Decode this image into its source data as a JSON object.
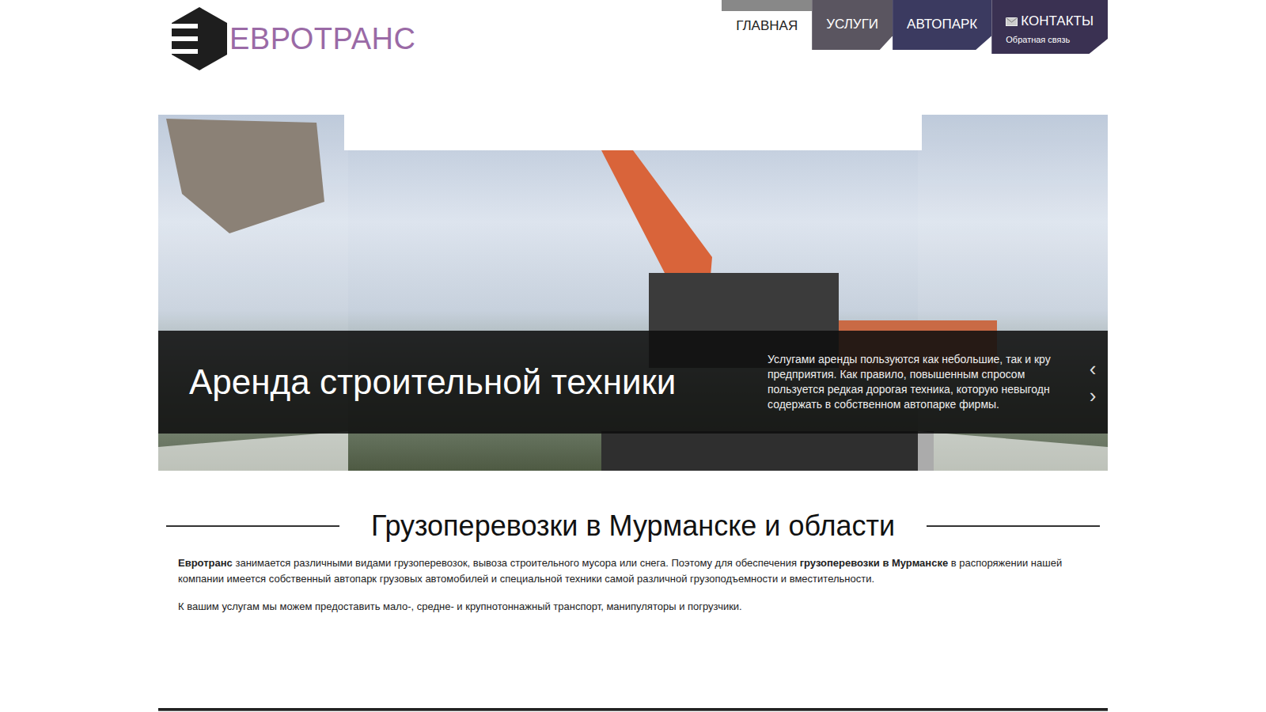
{
  "logo": {
    "text": "ЕВРОТРАНС"
  },
  "nav": [
    {
      "label": "ГЛАВНАЯ",
      "selected": true
    },
    {
      "label": "УСЛУГИ",
      "selected": false
    },
    {
      "label": "АВТОПАРК",
      "selected": false
    },
    {
      "label": "КОНТАКТЫ",
      "sublabel": "Обратная связь",
      "selected": false
    }
  ],
  "slider": {
    "title": "Аренда строительной техники",
    "text_lines": [
      "Услугами аренды пользуются как небольшие, так и кру",
      "предприятия. Как правило, повышенным спросом",
      "пользуется редкая дорогая техника, которую невыгодн",
      "содержать в собственном автопарке фирмы."
    ],
    "prev": "‹",
    "next": "›"
  },
  "section": {
    "heading": "Грузоперевозки в Мурманске и области",
    "paragraphs": [
      [
        {
          "text": "Евротранс",
          "bold": true
        },
        {
          "text": " занимается различными видами грузоперевозок, вывоза строительного мусора или снега. Поэтому для обеспечения ",
          "bold": false
        },
        {
          "text": "грузоперевозки в Мурманске",
          "bold": true
        },
        {
          "text": " в распоряжении нашей компании имеется собственный автопарк грузовых автомобилей и специальной техники самой различной грузоподъемности и вместительности.",
          "bold": false
        }
      ],
      [
        {
          "text": "К вашим услугам мы можем предоставить мало-, средне- и крупнотоннажный транспорт, манипуляторы и погрузчики.",
          "bold": false
        }
      ]
    ]
  }
}
